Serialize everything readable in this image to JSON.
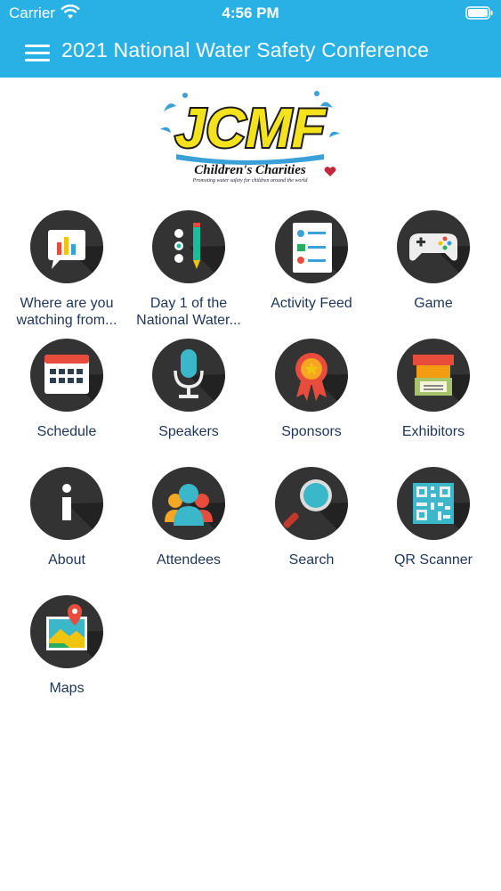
{
  "status_bar": {
    "carrier": "Carrier",
    "time": "4:56 PM"
  },
  "nav": {
    "title": "2021 National Water Safety Conference"
  },
  "logo": {
    "name": "JCMF",
    "subtitle": "Children's Charities",
    "tagline": "Promoting water safety for children around the world"
  },
  "tiles": [
    {
      "line1": "Where are you",
      "line2": "watching from..."
    },
    {
      "line1": "Day 1 of the",
      "line2": "National Water..."
    },
    {
      "line1": "Activity Feed",
      "line2": ""
    },
    {
      "line1": "Game",
      "line2": ""
    },
    {
      "line1": "Schedule",
      "line2": ""
    },
    {
      "line1": "Speakers",
      "line2": ""
    },
    {
      "line1": "Sponsors",
      "line2": ""
    },
    {
      "line1": "Exhibitors",
      "line2": ""
    },
    {
      "line1": "About",
      "line2": ""
    },
    {
      "line1": "Attendees",
      "line2": ""
    },
    {
      "line1": "Search",
      "line2": ""
    },
    {
      "line1": "QR Scanner",
      "line2": ""
    },
    {
      "line1": "Maps",
      "line2": ""
    }
  ],
  "colors": {
    "header": "#29b1e5",
    "label": "#1d3557",
    "icon_bg": "#333333"
  }
}
